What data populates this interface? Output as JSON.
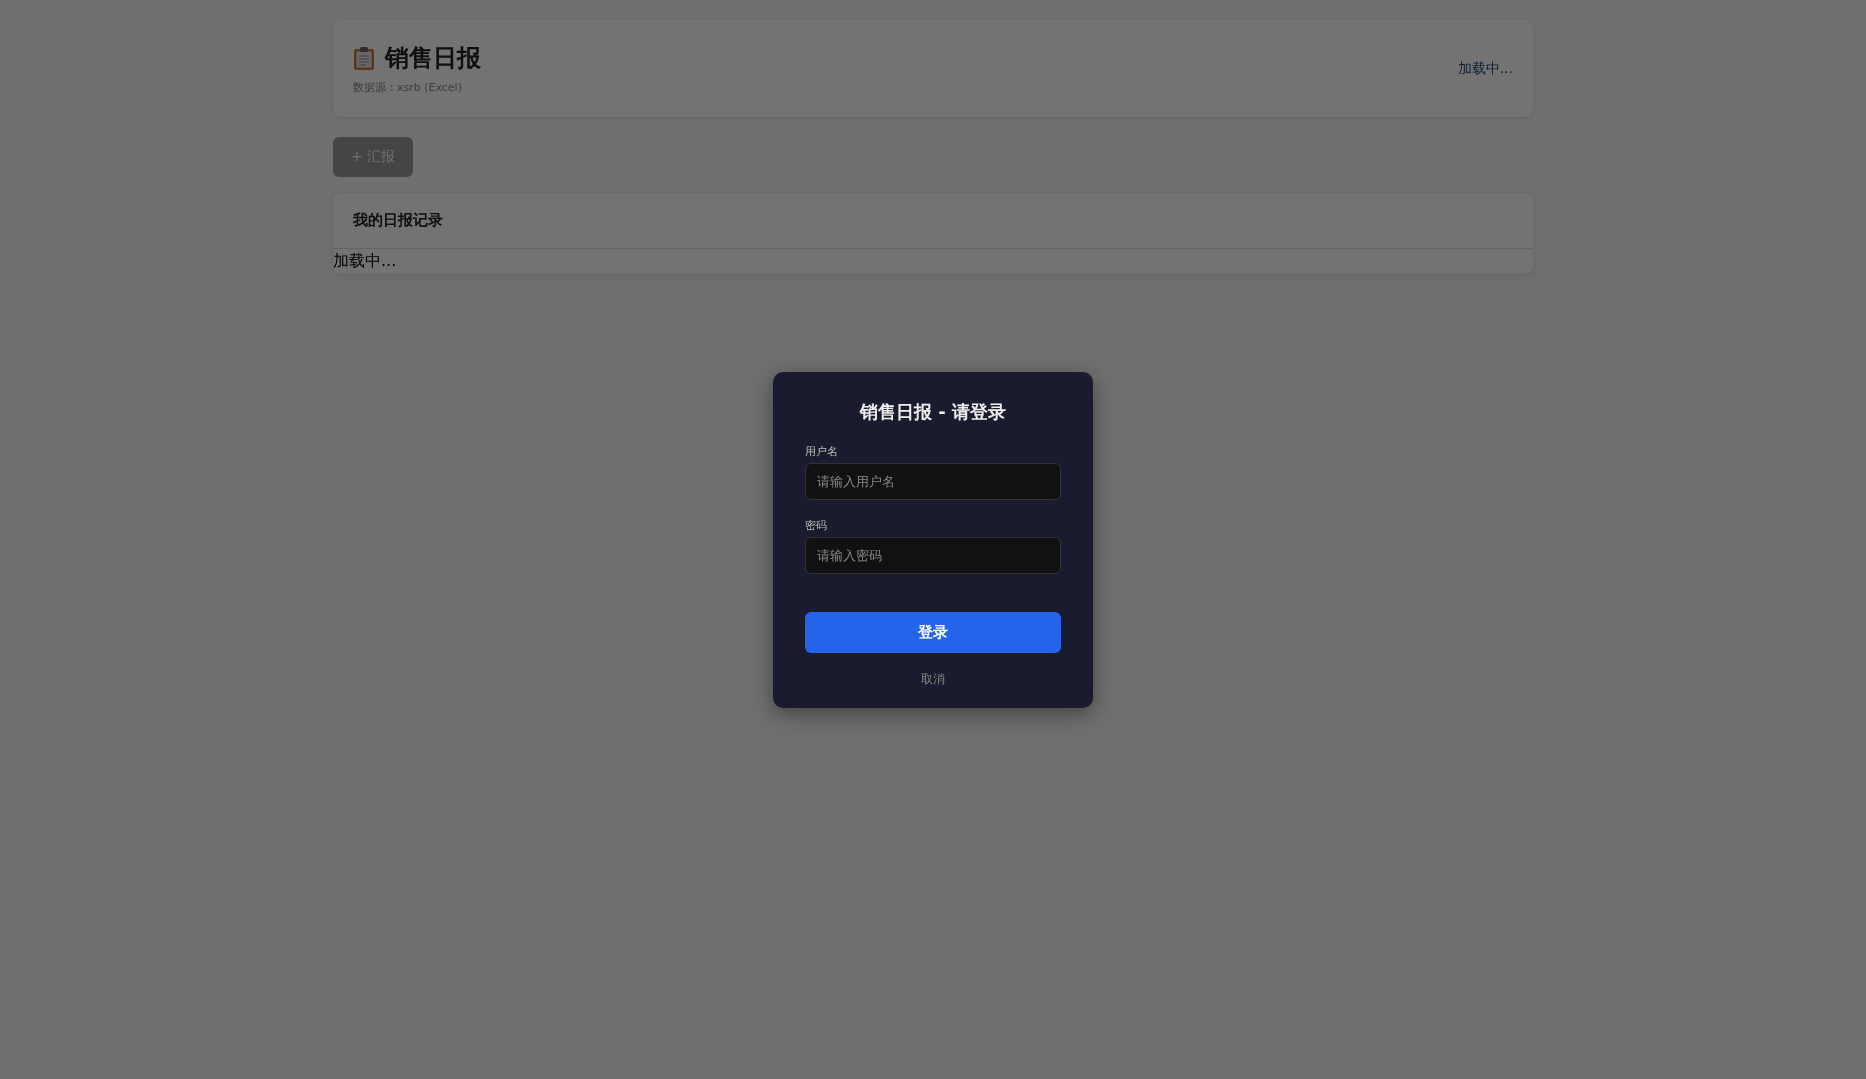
{
  "header": {
    "title": "销售日报",
    "subtitle": "数据源：xsrb (Excel)",
    "status": "加载中..."
  },
  "report_button": {
    "label": "+ 汇报",
    "disabled": true
  },
  "records": {
    "title": "我的日报记录",
    "status": "加载中..."
  },
  "login_dialog": {
    "title": "销售日报 - 请登录",
    "fields": [
      {
        "label": "用户名",
        "placeholder": "请输入用户名"
      },
      {
        "label": "密码",
        "placeholder": "请输入密码"
      }
    ],
    "submit": "登录",
    "cancel": "取消"
  }
}
